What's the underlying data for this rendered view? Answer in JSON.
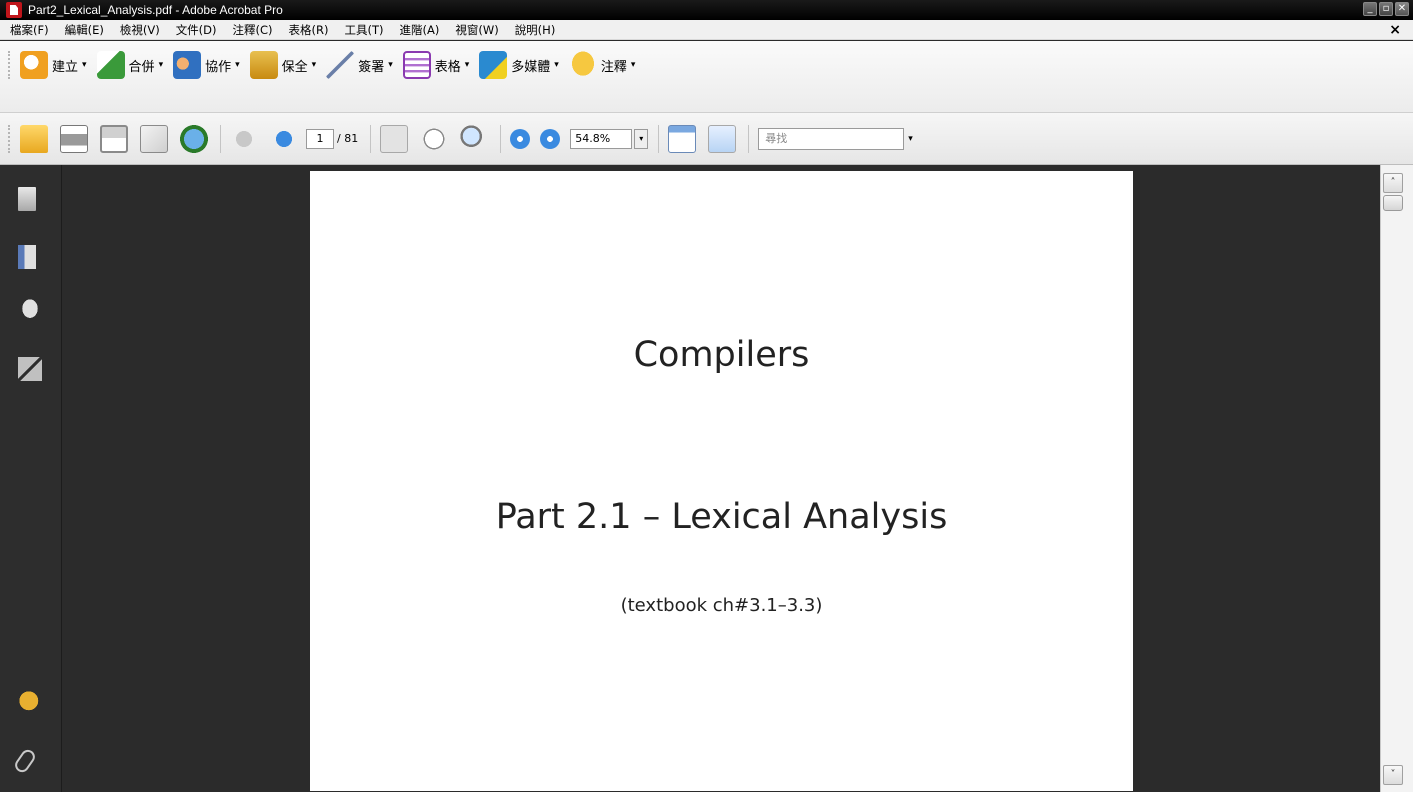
{
  "window": {
    "title": "Part2_Lexical_Analysis.pdf - Adobe Acrobat Pro",
    "controls": [
      "_",
      "▫",
      "✕"
    ]
  },
  "menubar": {
    "items": [
      "檔案(F)",
      "編輯(E)",
      "檢視(V)",
      "文件(D)",
      "注釋(C)",
      "表格(R)",
      "工具(T)",
      "進階(A)",
      "視窗(W)",
      "說明(H)"
    ],
    "doc_close": "×"
  },
  "tasks": {
    "items": [
      {
        "label": "建立",
        "icon": "create-pdf-icon",
        "color": "#f0a020"
      },
      {
        "label": "合併",
        "icon": "combine-files-icon",
        "color": "#3a9a3a"
      },
      {
        "label": "協作",
        "icon": "collaborate-icon",
        "color": "#3070c0"
      },
      {
        "label": "保全",
        "icon": "secure-lock-icon",
        "color": "#d8a020"
      },
      {
        "label": "簽署",
        "icon": "sign-pen-icon",
        "color": "#6a7fa8"
      },
      {
        "label": "表格",
        "icon": "forms-icon",
        "color": "#8a3ab0"
      },
      {
        "label": "多媒體",
        "icon": "multimedia-icon",
        "color": "#2a8ad0"
      },
      {
        "label": "注釋",
        "icon": "comment-icon",
        "color": "#f0b020"
      }
    ],
    "caret": "▾"
  },
  "toolbar": {
    "current_page": "1",
    "page_count": "/ 81",
    "zoom": "54.8%",
    "zoom_caret": "▾",
    "find_placeholder": "尋找",
    "find_caret": "▾"
  },
  "document": {
    "title": "Compilers",
    "subtitle": "Part 2.1 – Lexical Analysis",
    "note": "(textbook ch#3.1–3.3)"
  },
  "scrollbar": {
    "up": "˄",
    "down": "˅"
  }
}
